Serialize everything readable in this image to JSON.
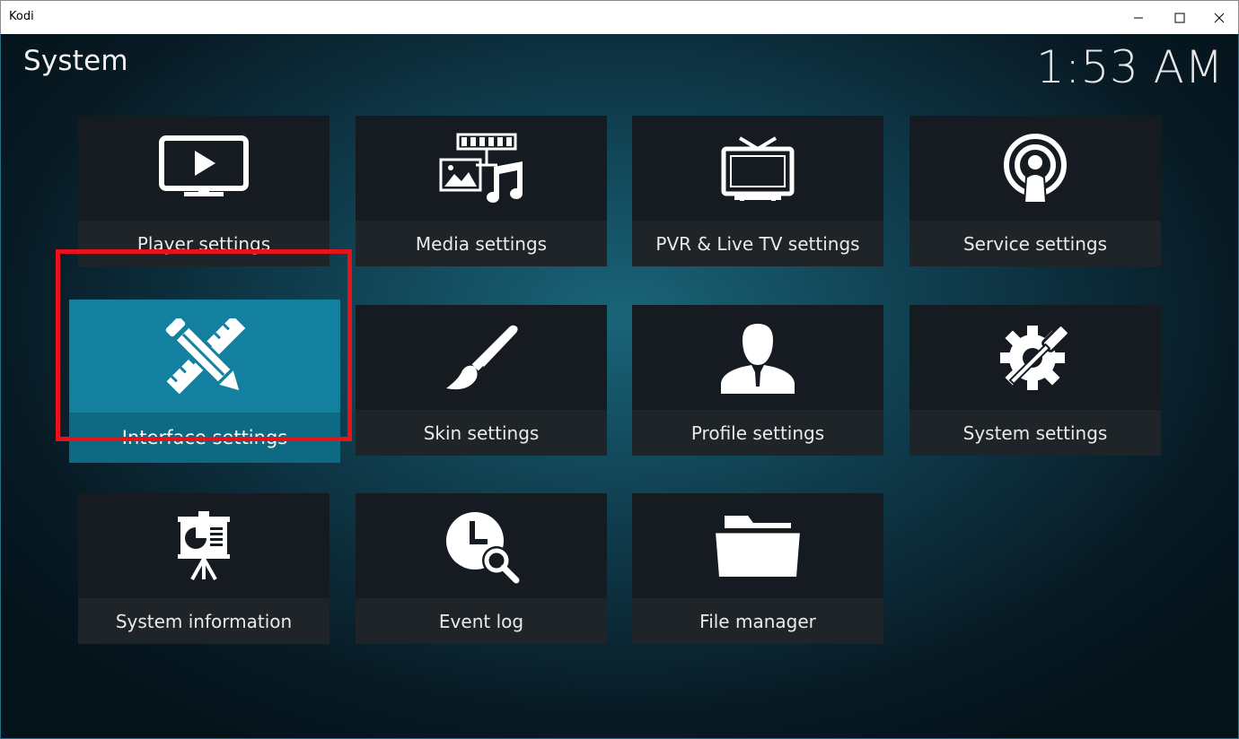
{
  "window": {
    "title": "Kodi",
    "controls": [
      "minimize-icon",
      "maximize-icon",
      "close-icon"
    ]
  },
  "header": {
    "title": "System",
    "clock": "1:53 AM"
  },
  "tiles": [
    {
      "id": "player",
      "label": "Player settings",
      "icon": "tv-play-icon"
    },
    {
      "id": "media",
      "label": "Media settings",
      "icon": "media-icon"
    },
    {
      "id": "pvr",
      "label": "PVR & Live TV settings",
      "icon": "antenna-tv-icon"
    },
    {
      "id": "service",
      "label": "Service settings",
      "icon": "broadcast-icon"
    },
    {
      "id": "interface",
      "label": "Interface settings",
      "icon": "pencil-ruler-icon",
      "focused": true
    },
    {
      "id": "skin",
      "label": "Skin settings",
      "icon": "paintbrush-icon"
    },
    {
      "id": "profile",
      "label": "Profile settings",
      "icon": "user-icon"
    },
    {
      "id": "system",
      "label": "System settings",
      "icon": "gear-tools-icon"
    },
    {
      "id": "sysinfo",
      "label": "System information",
      "icon": "presentation-icon"
    },
    {
      "id": "eventlog",
      "label": "Event log",
      "icon": "clock-search-icon"
    },
    {
      "id": "filemanager",
      "label": "File manager",
      "icon": "folder-icon"
    }
  ],
  "colors": {
    "focus_tile": "#12809e",
    "highlight": "#e8131a",
    "tile_bg": "#151b20"
  }
}
